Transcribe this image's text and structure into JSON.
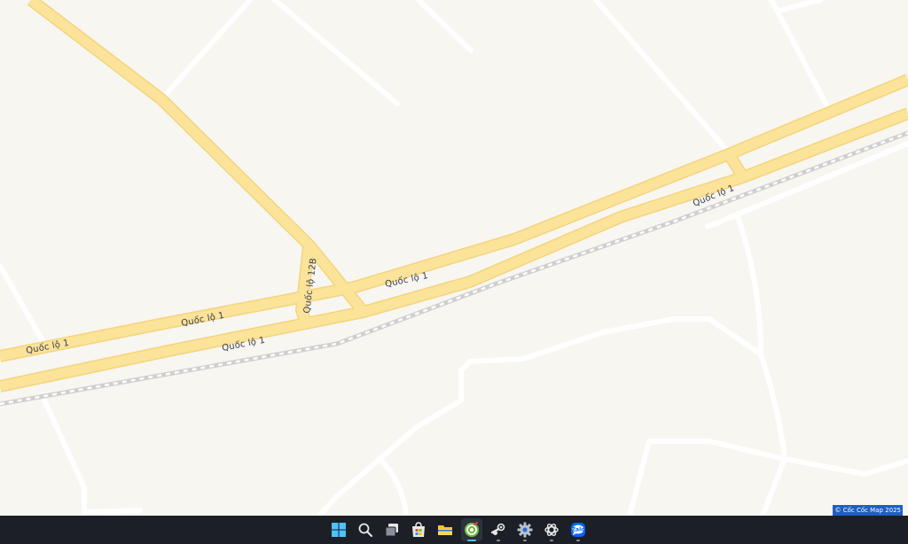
{
  "map": {
    "road_labels": [
      {
        "text": "Quốc lộ 1"
      },
      {
        "text": "Quốc lộ 1"
      },
      {
        "text": "Quốc lộ 1"
      },
      {
        "text": "Quốc lộ 1"
      },
      {
        "text": "Quốc lộ 1"
      },
      {
        "text": "Quốc lộ 12B"
      }
    ],
    "colors": {
      "background": "#f8f6f1",
      "highway": "#fbe39a",
      "highway_casing": "#f6d883",
      "minor_road": "#ffffff",
      "railway": "#dcdcdc"
    },
    "copyright": "© Cốc Cốc Map 2025"
  },
  "taskbar": {
    "icons": [
      {
        "name": "windows-start-icon",
        "active": false
      },
      {
        "name": "search-icon",
        "active": false
      },
      {
        "name": "task-view-icon",
        "active": false
      },
      {
        "name": "microsoft-store-icon",
        "active": false
      },
      {
        "name": "file-explorer-icon",
        "active": false
      },
      {
        "name": "coccoc-browser-icon",
        "active": true
      },
      {
        "name": "steam-icon",
        "active": false
      },
      {
        "name": "settings-gear-icon",
        "active": false
      },
      {
        "name": "chatgpt-icon",
        "active": false
      },
      {
        "name": "zalo-icon",
        "active": false
      }
    ],
    "zalo_label": "Zalo"
  }
}
